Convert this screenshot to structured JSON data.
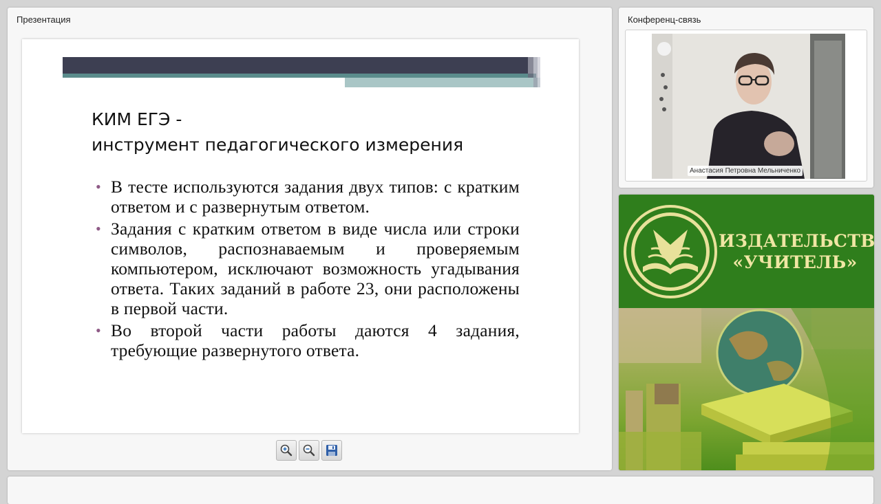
{
  "presentation": {
    "panel_title": "Презентация",
    "slide": {
      "title_line1": "КИМ  ЕГЭ -",
      "title_line2": "инструмент педагогического измерения",
      "bullets": [
        "В  тесте используются задания  двух  типов:  с кратким ответом и  с развернутым  ответом.",
        "Задания  с  кратким  ответом  в  виде  числа или  строки  символов,  распознаваемым  и проверяемым  компьютером,  исключают возможность  угадывания  ответа.  Таких заданий  в  работе  23,  они  расположены  в первой  части.",
        "Во  второй  части  работы  даются  4  задания, требующие  развернутого ответа."
      ],
      "bullet_color": "#8e5a86"
    },
    "tools": [
      "zoom-in-icon",
      "zoom-out-icon",
      "save-icon"
    ]
  },
  "conference": {
    "panel_title": "Конференц-связь",
    "speaker_name": "Анастасия Петровна Мельниченко"
  },
  "publisher": {
    "line1": "ИЗДАТЕЛЬСТВО",
    "line2": "«УЧИТЕЛЬ»",
    "brand_color": "#2f7e1c",
    "text_color": "#f0e6a4"
  }
}
